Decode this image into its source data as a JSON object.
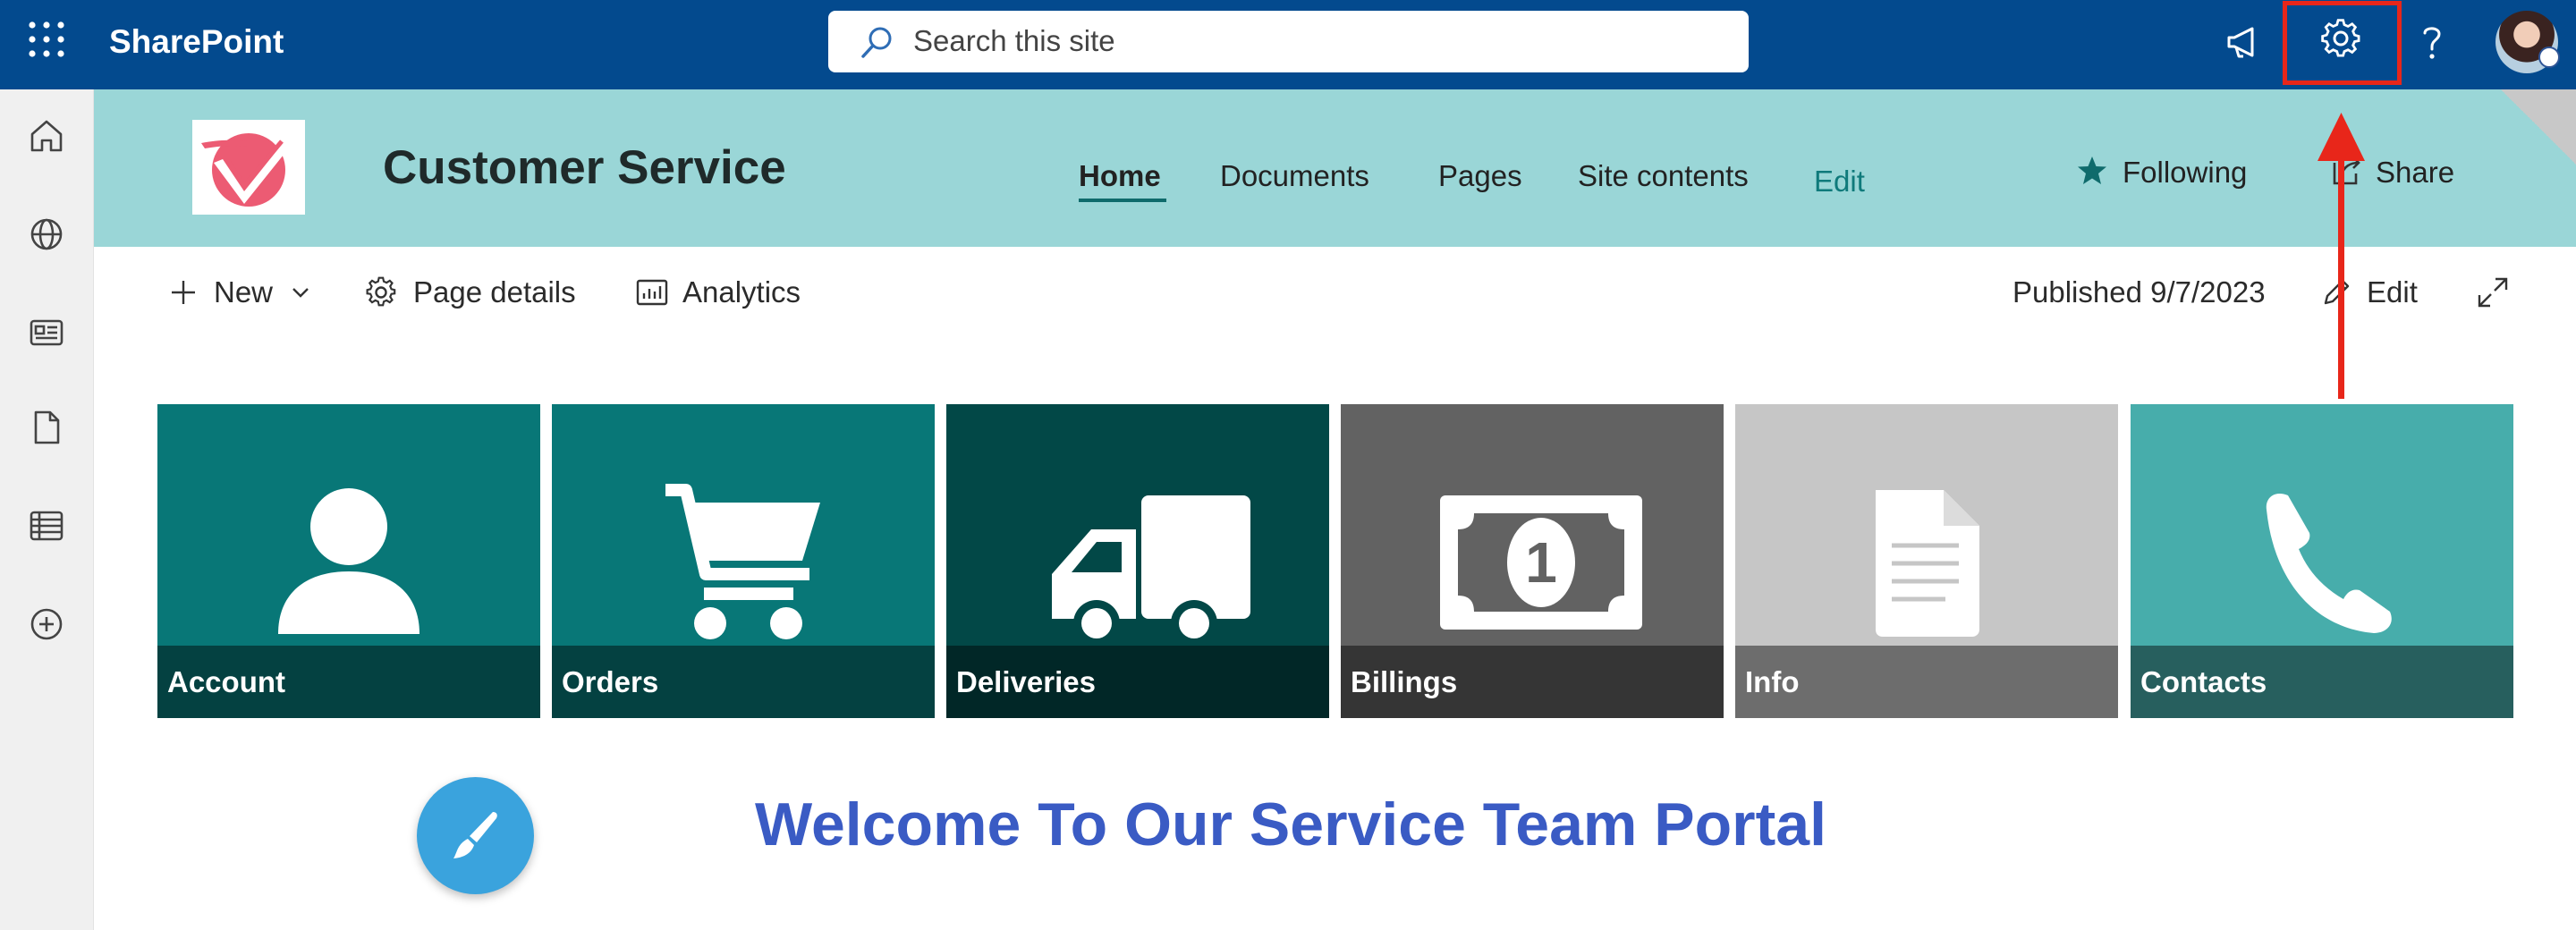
{
  "suite": {
    "brand": "SharePoint",
    "search_placeholder": "Search this site"
  },
  "site": {
    "title": "Customer Service",
    "nav": [
      {
        "label": "Home",
        "active": true
      },
      {
        "label": "Documents"
      },
      {
        "label": "Pages"
      },
      {
        "label": "Site contents"
      },
      {
        "label": "Edit"
      }
    ],
    "following_label": "Following",
    "share_label": "Share"
  },
  "command_bar": {
    "new_label": "New",
    "page_details_label": "Page details",
    "analytics_label": "Analytics",
    "published_label": "Published 9/7/2023",
    "edit_label": "Edit"
  },
  "tiles": [
    {
      "label": "Account",
      "icon": "person-icon",
      "color": "#087777"
    },
    {
      "label": "Orders",
      "icon": "cart-icon",
      "color": "#087777"
    },
    {
      "label": "Deliveries",
      "icon": "truck-icon",
      "color": "#024847"
    },
    {
      "label": "Billings",
      "icon": "banknote-icon",
      "color": "#626262"
    },
    {
      "label": "Info",
      "icon": "document-icon",
      "color": "#c6c6c6"
    },
    {
      "label": "Contacts",
      "icon": "phone-icon",
      "color": "#47adab"
    }
  ],
  "welcome_text": "Welcome To Our Service Team Portal",
  "colors": {
    "suite_bar": "#034a8e",
    "site_header": "#9ad6d7",
    "welcome": "#3a5bc4",
    "annotation": "#e8261a"
  }
}
